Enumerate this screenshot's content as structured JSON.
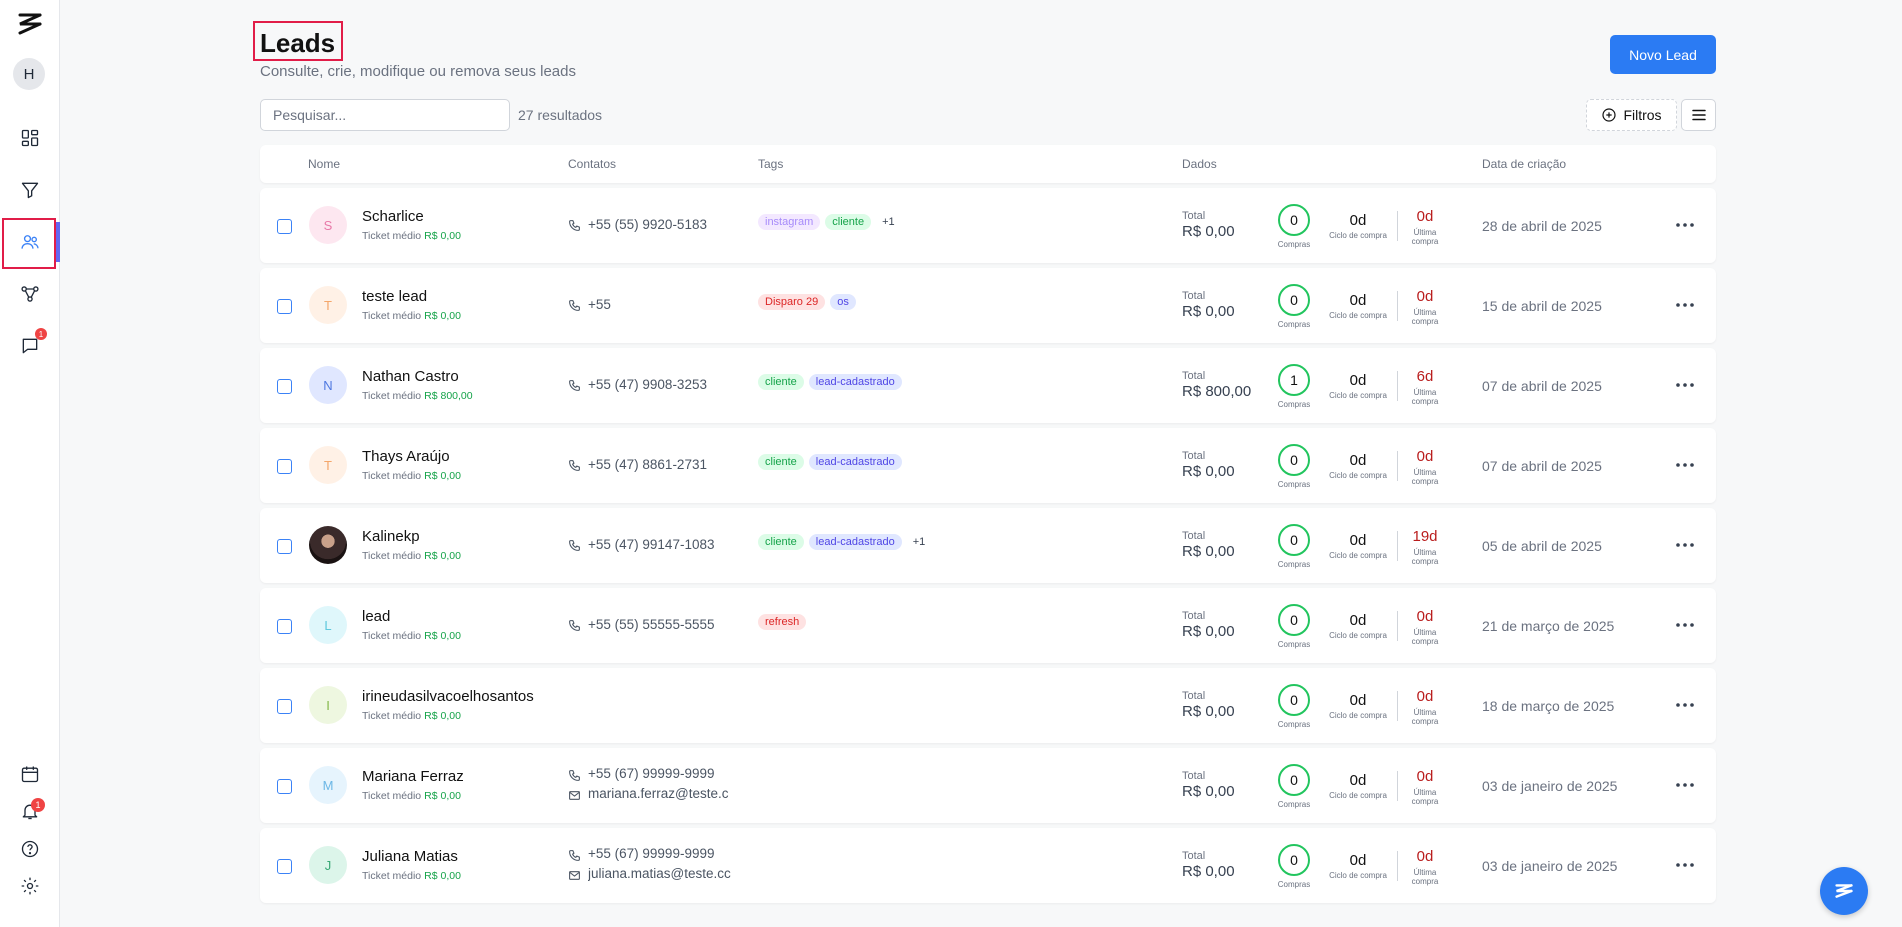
{
  "sidebar": {
    "avatar_letter": "H",
    "chat_badge": "1",
    "notifications_badge": "1",
    "icons": [
      "logo-icon",
      "dashboard-icon",
      "filter-icon",
      "users-icon",
      "workflow-icon",
      "chat-icon",
      "calendar-icon",
      "bell-icon",
      "help-icon",
      "settings-icon"
    ]
  },
  "header": {
    "title": "Leads",
    "subtitle": "Consulte, crie, modifique ou remova seus leads",
    "new_lead_label": "Novo Lead"
  },
  "toolbar": {
    "search_placeholder": "Pesquisar...",
    "results_count": "27 resultados",
    "filters_label": "Filtros"
  },
  "table": {
    "columns": {
      "name": "Nome",
      "contacts": "Contatos",
      "tags": "Tags",
      "data": "Dados",
      "created": "Data de criação"
    },
    "labels": {
      "ticket": "Ticket médio",
      "total": "Total",
      "compras": "Compras",
      "cycle": "Ciclo de compra",
      "last": "Última compra"
    },
    "rows": [
      {
        "initial": "S",
        "name": "Scharlice",
        "ticket": "R$ 0,00",
        "phone": "+55 (55) 9920-5183",
        "email": "",
        "tags": [
          {
            "label": "instagram",
            "color": "purple"
          },
          {
            "label": "cliente",
            "color": "green"
          }
        ],
        "more": "+1",
        "total": "R$ 0,00",
        "purchases": "0",
        "cycle": "0d",
        "last": "0d",
        "date": "28 de abril de 2025",
        "avatar_bg": "#fde7f0",
        "avatar_fg": "#e879a8"
      },
      {
        "initial": "T",
        "name": "teste lead",
        "ticket": "R$ 0,00",
        "phone": "+55",
        "email": "",
        "tags": [
          {
            "label": "Disparo 29",
            "color": "red"
          },
          {
            "label": "os",
            "color": "indigo"
          }
        ],
        "more": "",
        "total": "R$ 0,00",
        "purchases": "0",
        "cycle": "0d",
        "last": "0d",
        "date": "15 de abril de 2025",
        "avatar_bg": "#fff1e6",
        "avatar_fg": "#f4a66a"
      },
      {
        "initial": "N",
        "name": "Nathan Castro",
        "ticket": "R$ 800,00",
        "phone": "+55 (47) 9908-3253",
        "email": "",
        "tags": [
          {
            "label": "cliente",
            "color": "green"
          },
          {
            "label": "lead-cadastrado",
            "color": "indigo"
          }
        ],
        "more": "",
        "total": "R$ 800,00",
        "purchases": "1",
        "cycle": "0d",
        "last": "6d",
        "date": "07 de abril de 2025",
        "avatar_bg": "#e0e7ff",
        "avatar_fg": "#4f78e0"
      },
      {
        "initial": "T",
        "name": "Thays Araújo",
        "ticket": "R$ 0,00",
        "phone": "+55 (47) 8861-2731",
        "email": "",
        "tags": [
          {
            "label": "cliente",
            "color": "green"
          },
          {
            "label": "lead-cadastrado",
            "color": "indigo"
          }
        ],
        "more": "",
        "total": "R$ 0,00",
        "purchases": "0",
        "cycle": "0d",
        "last": "0d",
        "date": "07 de abril de 2025",
        "avatar_bg": "#fff1e6",
        "avatar_fg": "#f4a66a"
      },
      {
        "initial": "",
        "name": "Kalinekp",
        "ticket": "R$ 0,00",
        "phone": "+55 (47) 99147-1083",
        "email": "",
        "tags": [
          {
            "label": "cliente",
            "color": "green"
          },
          {
            "label": "lead-cadastrado",
            "color": "indigo"
          }
        ],
        "more": "+1",
        "total": "R$ 0,00",
        "purchases": "0",
        "cycle": "0d",
        "last": "19d",
        "date": "05 de abril de 2025",
        "avatar_bg": "#3a2a2a",
        "avatar_fg": "#ffffff"
      },
      {
        "initial": "L",
        "name": "lead",
        "ticket": "R$ 0,00",
        "phone": "+55 (55) 55555-5555",
        "email": "",
        "tags": [
          {
            "label": "refresh",
            "color": "red"
          }
        ],
        "more": "",
        "total": "R$ 0,00",
        "purchases": "0",
        "cycle": "0d",
        "last": "0d",
        "date": "21 de março de 2025",
        "avatar_bg": "#dff7fb",
        "avatar_fg": "#5ec8dc"
      },
      {
        "initial": "I",
        "name": "irineudasilvacoelhosantos",
        "ticket": "R$ 0,00",
        "phone": "",
        "email": "",
        "tags": [],
        "more": "",
        "total": "R$ 0,00",
        "purchases": "0",
        "cycle": "0d",
        "last": "0d",
        "date": "18 de março de 2025",
        "avatar_bg": "#eef7e0",
        "avatar_fg": "#84b84a"
      },
      {
        "initial": "M",
        "name": "Mariana Ferraz",
        "ticket": "R$ 0,00",
        "phone": "+55 (67) 99999-9999",
        "email": "mariana.ferraz@teste.c",
        "tags": [],
        "more": "",
        "total": "R$ 0,00",
        "purchases": "0",
        "cycle": "0d",
        "last": "0d",
        "date": "03 de janeiro de 2025",
        "avatar_bg": "#e6f4fd",
        "avatar_fg": "#6cb7e6"
      },
      {
        "initial": "J",
        "name": "Juliana Matias",
        "ticket": "R$ 0,00",
        "phone": "+55 (67) 99999-9999",
        "email": "juliana.matias@teste.cc",
        "tags": [],
        "more": "",
        "total": "R$ 0,00",
        "purchases": "0",
        "cycle": "0d",
        "last": "0d",
        "date": "03 de janeiro de 2025",
        "avatar_bg": "#dcf5ea",
        "avatar_fg": "#3aa876"
      }
    ]
  },
  "colors": {
    "accent": "#2b7bf3",
    "success": "#16a34a",
    "danger": "#b91c1c",
    "highlight_box": "#e11d48"
  }
}
